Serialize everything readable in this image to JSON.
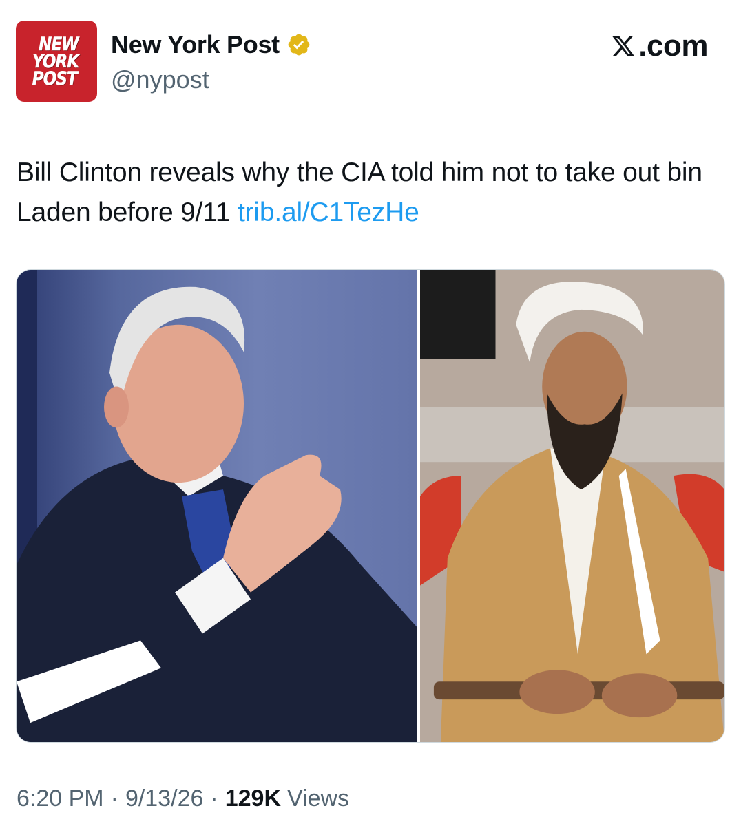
{
  "author": {
    "logo_lines": [
      "NEW",
      "YORK",
      "POST"
    ],
    "display_name": "New York Post",
    "handle": "@nypost",
    "verified_icon": "gold-verified-badge"
  },
  "site_label": ".com",
  "site_icon": "x-logo-icon",
  "tweet": {
    "text": "Bill Clinton reveals why the CIA told him not to take out bin Laden before 9/11 ",
    "link": "trib.al/C1TezHe"
  },
  "media": {
    "left_photo": "photo-of-man-in-suit-gesturing",
    "right_photo": "photo-of-man-in-white-turban"
  },
  "meta": {
    "time": "6:20 PM",
    "separator": "·",
    "date": "9/13/26",
    "views_count": "129K",
    "views_label": "Views"
  },
  "colors": {
    "brand_red": "#c8232c",
    "link_blue": "#1d9bf0",
    "secondary_text": "#536471",
    "badge_gold": "#e2b719"
  }
}
